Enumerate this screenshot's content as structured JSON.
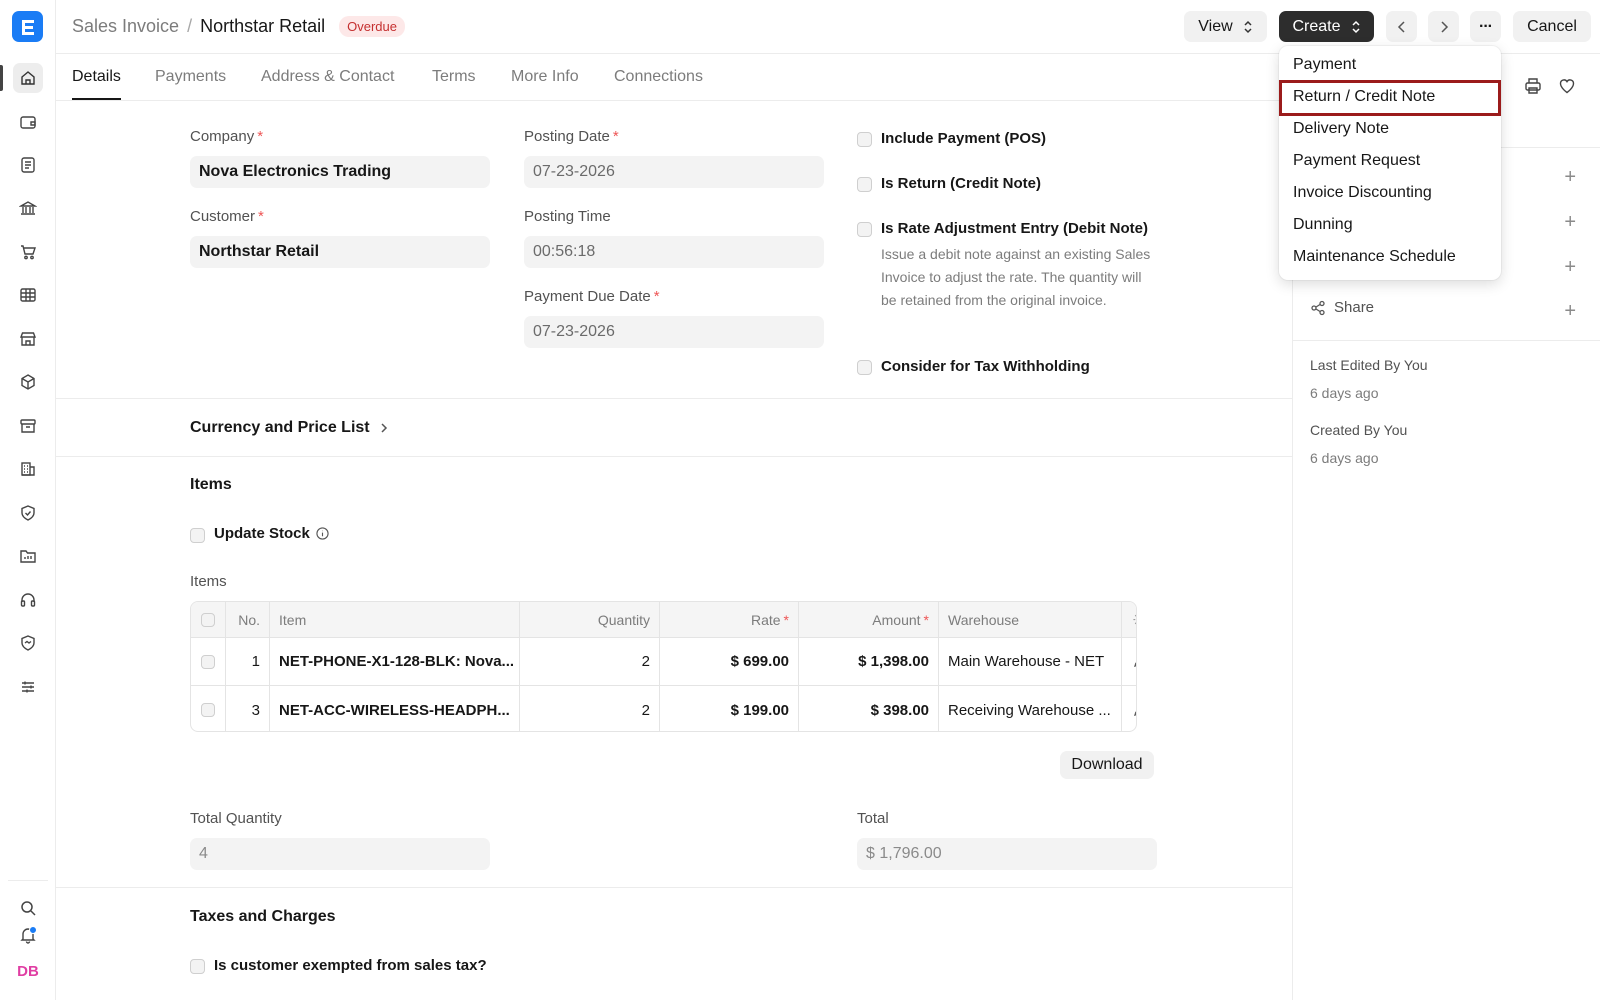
{
  "header": {
    "breadcrumb_parent": "Sales Invoice",
    "breadcrumb_sep": "/",
    "breadcrumb_current": "Northstar Retail",
    "status_badge": "Overdue",
    "view_label": "View",
    "create_label": "Create",
    "more_label": "···",
    "cancel_label": "Cancel"
  },
  "tabs": [
    "Details",
    "Payments",
    "Address & Contact",
    "Terms",
    "More Info",
    "Connections"
  ],
  "form": {
    "company_label": "Company",
    "company_value": "Nova Electronics Trading",
    "customer_label": "Customer",
    "customer_value": "Northstar Retail",
    "posting_date_label": "Posting Date",
    "posting_date_value": "07-23-2026",
    "posting_time_label": "Posting Time",
    "posting_time_value": "00:56:18",
    "due_date_label": "Payment Due Date",
    "due_date_value": "07-23-2026",
    "include_payment_label": "Include Payment (POS)",
    "is_return_label": "Is Return (Credit Note)",
    "rate_adjust_label": "Is Rate Adjustment Entry (Debit Note)",
    "rate_adjust_help": "Issue a debit note against an existing Sales Invoice to adjust the rate. The quantity will be retained from the original invoice.",
    "tax_withholding_label": "Consider for Tax Withholding",
    "required_mark": "*"
  },
  "sections": {
    "currency": "Currency and Price List",
    "items": "Items",
    "update_stock": "Update Stock",
    "items_table_label": "Items",
    "taxes": "Taxes and Charges",
    "tax_exempt": "Is customer exempted from sales tax?"
  },
  "items_table": {
    "columns": {
      "no": "No.",
      "item": "Item",
      "quantity": "Quantity",
      "rate": "Rate",
      "amount": "Amount",
      "warehouse": "Warehouse"
    },
    "rows": [
      {
        "no": "1",
        "item": "NET-PHONE-X1-128-BLK: Nova...",
        "quantity": "2",
        "rate": "$ 699.00",
        "amount": "$ 1,398.00",
        "warehouse": "Main Warehouse - NET"
      },
      {
        "no": "3",
        "item": "NET-ACC-WIRELESS-HEADPH...",
        "quantity": "2",
        "rate": "$ 199.00",
        "amount": "$ 398.00",
        "warehouse": "Receiving Warehouse ..."
      }
    ],
    "download_label": "Download"
  },
  "totals": {
    "total_qty_label": "Total Quantity",
    "total_qty_value": "4",
    "total_label": "Total",
    "total_value": "$ 1,796.00"
  },
  "create_menu": {
    "items": [
      "Payment",
      "Return / Credit Note",
      "Delivery Note",
      "Payment Request",
      "Invoice Discounting",
      "Dunning",
      "Maintenance Schedule"
    ],
    "highlighted": "Return / Credit Note"
  },
  "right_panel": {
    "share_label": "Share",
    "last_edited": "Last Edited By You",
    "last_edited_time": "6 days ago",
    "created": "Created By You",
    "created_time": "6 days ago"
  },
  "user": {
    "initials": "DB"
  },
  "colors": {
    "accent": "#1a7cf5",
    "badge_bg": "#fde8e8",
    "badge_text": "#c53030",
    "highlight_border": "#9b1b1b",
    "avatar": "#e03ea3"
  }
}
